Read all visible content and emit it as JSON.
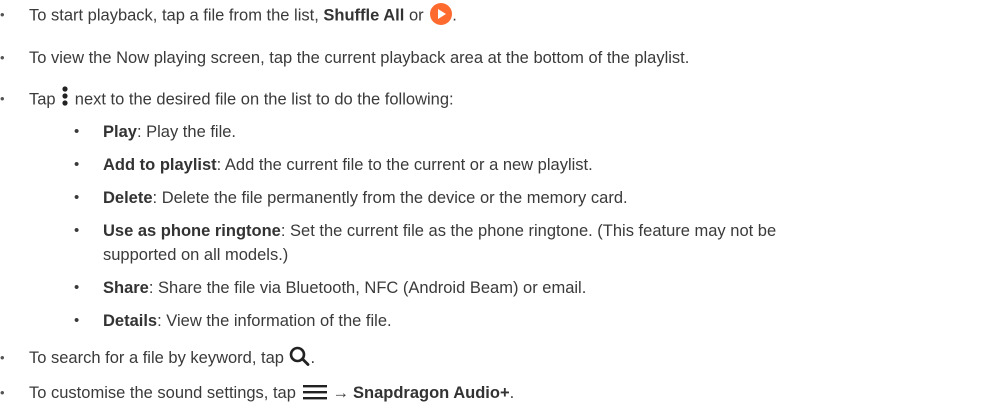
{
  "items": [
    {
      "pre": "To start playback, tap a file from the list, ",
      "bold": "Shuffle All",
      "mid": " or ",
      "icon": "play-circle-icon",
      "post": "."
    },
    {
      "text": "To view the Now playing screen, tap the current playback area at the bottom of the playlist."
    },
    {
      "pre": "Tap ",
      "icon": "more-vertical-icon",
      "post": " next to the desired file on the list to do the following:"
    },
    {
      "text": "To search for a file by keyword, tap ",
      "icon": "search-icon",
      "post": "."
    },
    {
      "pre": "To customise the sound settings, tap ",
      "icon": "menu-icon",
      "arrow": "→",
      "bold": "Snapdragon Audio+",
      "post": "."
    }
  ],
  "subitems": [
    {
      "bold": "Play",
      "text": ": Play the file."
    },
    {
      "bold": "Add to playlist",
      "text": ": Add the current file to the current or a new playlist."
    },
    {
      "bold": "Delete",
      "text": ": Delete the file permanently from the device or the memory card."
    },
    {
      "bold": "Use as phone ringtone",
      "text": ": Set the current file as the phone ringtone. (This feature may not be",
      "text2": "supported on all models.)"
    },
    {
      "bold": "Share",
      "text": ": Share the file via Bluetooth, NFC (Android Beam) or email."
    },
    {
      "bold": "Details",
      "text": ": View the information of the file."
    }
  ],
  "bullet_outer": "•",
  "bullet_inner": "•",
  "colors": {
    "accent_play": "#ff6a2f",
    "text": "#3a3a3a"
  }
}
